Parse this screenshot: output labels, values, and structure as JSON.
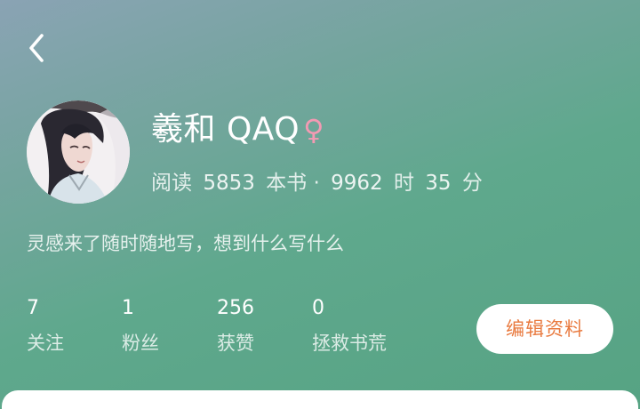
{
  "profile": {
    "name": "羲和 QAQ",
    "gender_symbol": "♀",
    "reading_prefix": "阅读",
    "books_read": "5853",
    "books_unit": "本书 ·",
    "hours": "9962",
    "hours_unit": "时",
    "minutes": "35",
    "minutes_unit": "分",
    "bio": "灵感来了随时随地写，想到什么写什么"
  },
  "stats": [
    {
      "value": "7",
      "label": "关注"
    },
    {
      "value": "1",
      "label": "粉丝"
    },
    {
      "value": "256",
      "label": "获赞"
    },
    {
      "value": "0",
      "label": "拯救书荒"
    }
  ],
  "actions": {
    "edit_label": "编辑资料"
  },
  "icons": {
    "back": "chevron-left-icon",
    "avatar": "anime-character-avatar",
    "gender": "female-symbol"
  },
  "colors": {
    "background_start": "#8aa3b4",
    "background_end": "#56a383",
    "gender": "#f39ab3",
    "edit_button_text": "#e97a3f",
    "card": "#ffffff"
  }
}
